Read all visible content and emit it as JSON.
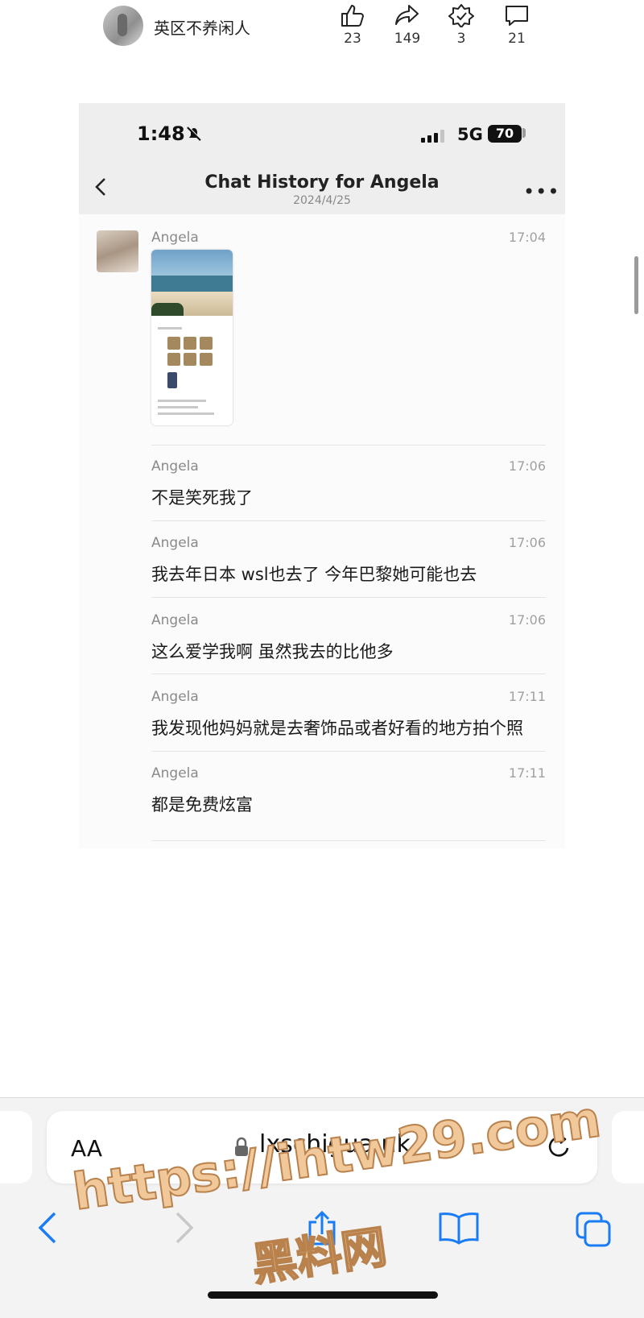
{
  "post": {
    "username": "英区不养闲人",
    "stats": [
      {
        "icon": "thumbs-up-icon",
        "count": "23"
      },
      {
        "icon": "share-icon",
        "count": "149"
      },
      {
        "icon": "badge-icon",
        "count": "3"
      },
      {
        "icon": "comment-icon",
        "count": "21"
      }
    ]
  },
  "screenshot": {
    "status": {
      "time": "1:48",
      "network": "5G",
      "battery": "70"
    },
    "header": {
      "title": "Chat History for Angela",
      "date": "2024/4/25"
    },
    "messages": [
      {
        "sender": "Angela",
        "time": "17:04",
        "text": ""
      },
      {
        "sender": "Angela",
        "time": "17:06",
        "text": "不是笑死我了"
      },
      {
        "sender": "Angela",
        "time": "17:06",
        "text": "我去年日本 wsl也去了 今年巴黎她可能也去"
      },
      {
        "sender": "Angela",
        "time": "17:06",
        "text": "这么爱学我啊 虽然我去的比他多"
      },
      {
        "sender": "Angela",
        "time": "17:11",
        "text": "我发现他妈妈就是去奢饰品或者好看的地方拍个照"
      },
      {
        "sender": "Angela",
        "time": "17:11",
        "text": "都是免费炫富"
      }
    ]
  },
  "browser": {
    "text_size_label": "AA",
    "url": "lxschigua.uk"
  },
  "watermark": {
    "url": "https://ihtw29.com",
    "name": "黑料网"
  },
  "colors": {
    "accent": "#1a7cf5",
    "watermark": "#f0c89a"
  }
}
